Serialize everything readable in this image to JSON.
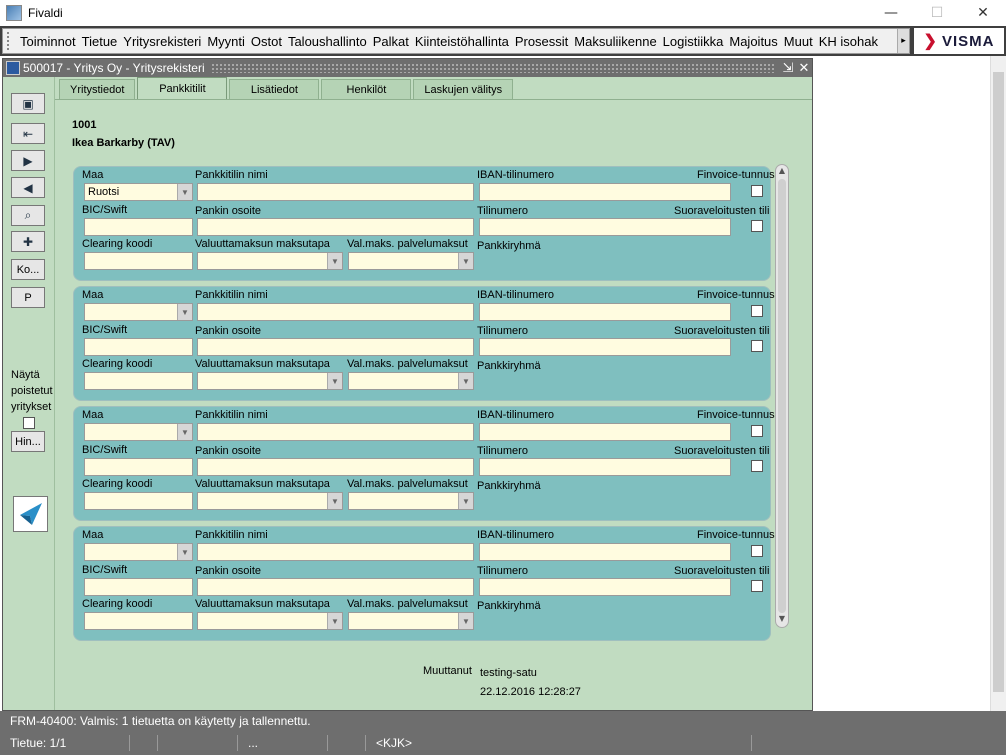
{
  "window": {
    "title": "Fivaldi",
    "minimize": "—",
    "maximize": "☐",
    "close": "✕"
  },
  "menu": {
    "items": [
      "Toiminnot",
      "Tietue",
      "Yritysrekisteri",
      "Myynti",
      "Ostot",
      "Taloushallinto",
      "Palkat",
      "Kiinteistöhallinta",
      "Prosessit",
      "Maksuliikenne",
      "Logistiikka",
      "Majoitus",
      "Muut",
      "KH isohak"
    ],
    "more_arrow": "▸",
    "brand": "VISMA"
  },
  "doc": {
    "title": "500017 - Yritys Oy - Yritysrekisteri",
    "ctrl_restore": "⇲",
    "ctrl_close": "✕"
  },
  "toolbar": {
    "ko_label": "Ko...",
    "p_label": "P",
    "show_deleted_label": [
      "Näytä",
      "poistetut",
      "yritykset"
    ],
    "hin_label": "Hin..."
  },
  "tabs": [
    "Yritystiedot",
    "Pankkitilit",
    "Lisätiedot",
    "Henkilöt",
    "Laskujen välitys"
  ],
  "active_tab": "Pankkitilit",
  "company": {
    "code": "1001",
    "name": "Ikea Barkarby (TAV)"
  },
  "labels": {
    "maa": "Maa",
    "account_name": "Pankkitilin nimi",
    "iban": "IBAN-tilinumero",
    "finvoice": "Finvoice-tunnus",
    "bic": "BIC/Swift",
    "bank_address": "Pankin osoite",
    "account_number": "Tilinumero",
    "direct_debit": "Suoraveloitusten tili",
    "clearing": "Clearing koodi",
    "fx_payment_method": "Valuuttamaksun maksutapa",
    "fx_service_fee": "Val.maks. palvelumaksut",
    "bank_group": "Pankkiryhmä"
  },
  "accounts": [
    {
      "country": "Ruotsi"
    },
    {
      "country": ""
    },
    {
      "country": ""
    },
    {
      "country": ""
    }
  ],
  "modified": {
    "label": "Muuttanut",
    "user": "testing-satu",
    "date": "22.12.2016 12:28:27"
  },
  "status": {
    "message": "FRM-40400: Valmis: 1 tietuetta on käytetty ja tallennettu.",
    "record": "Tietue: 1/1",
    "ellipsis": "...",
    "kjk": "<KJK>"
  }
}
